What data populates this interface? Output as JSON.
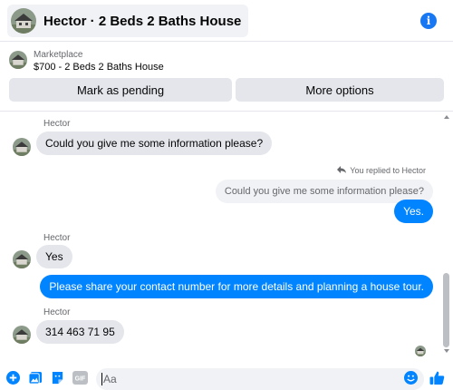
{
  "header": {
    "title": "Hector · 2 Beds 2 Baths House",
    "info_icon": "info-icon"
  },
  "listing": {
    "kicker": "Marketplace",
    "name": "$700 - 2 Beds 2 Baths House",
    "mark_pending_label": "Mark as pending",
    "more_options_label": "More options"
  },
  "chat": {
    "messages": [
      {
        "sender": "Hector",
        "text": "Could you give me some information please?"
      },
      {
        "replied_note": "You replied to Hector",
        "quoted": "Could you give me some information please?",
        "text": "Yes."
      },
      {
        "sender": "Hector",
        "text": "Yes"
      },
      {
        "text": "Please share your contact number for more details and planning a house tour."
      },
      {
        "sender": "Hector",
        "text": "314 463 71 95"
      }
    ]
  },
  "composer": {
    "placeholder": "Aa",
    "icons": [
      "plus-icon",
      "photo-icon",
      "sticker-icon",
      "gif-icon",
      "emoji-icon",
      "like-icon"
    ],
    "gif_label": "GIF"
  },
  "colors": {
    "accent": "#0084ff",
    "brand": "#1877f2",
    "bubble_in": "#e4e6eb",
    "button_bg": "#e4e6eb"
  }
}
